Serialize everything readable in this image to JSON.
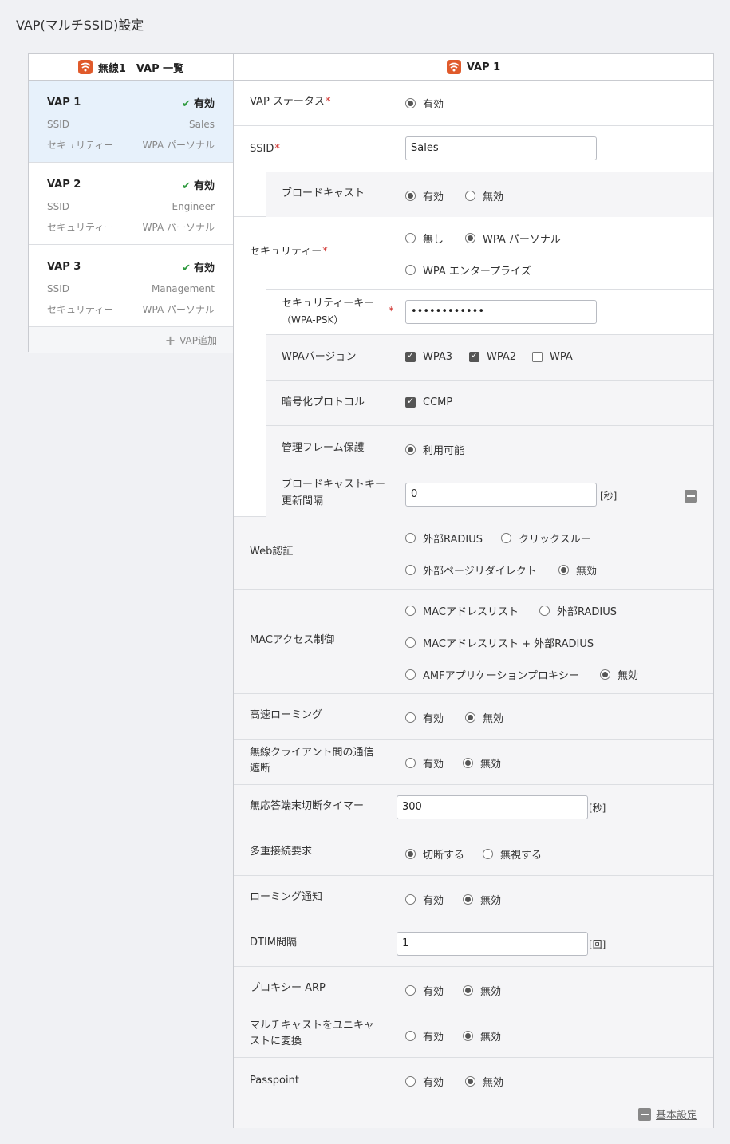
{
  "page_title": "VAP(マルチSSID)設定",
  "vap_list": {
    "header": "無線1　VAP 一覧",
    "items": [
      {
        "name": "VAP 1",
        "status": "有効",
        "ssid_label": "SSID",
        "ssid": "Sales",
        "security_label": "セキュリティー",
        "security": "WPA パーソナル"
      },
      {
        "name": "VAP 2",
        "status": "有効",
        "ssid_label": "SSID",
        "ssid": "Engineer",
        "security_label": "セキュリティー",
        "security": "WPA パーソナル"
      },
      {
        "name": "VAP 3",
        "status": "有効",
        "ssid_label": "SSID",
        "ssid": "Management",
        "security_label": "セキュリティー",
        "security": "WPA パーソナル"
      }
    ],
    "add_label": "VAP追加"
  },
  "detail": {
    "header": "VAP 1",
    "vap_status": {
      "label": "VAP ステータス",
      "required": "*",
      "option": "有効"
    },
    "ssid": {
      "label": "SSID",
      "required": "*",
      "value": "Sales"
    },
    "broadcast": {
      "label": "ブロードキャスト",
      "opt_enable": "有効",
      "opt_disable": "無効"
    },
    "security": {
      "label": "セキュリティー",
      "required": "*",
      "opt_none": "無し",
      "opt_personal": "WPA パーソナル",
      "opt_enterprise": "WPA エンタープライズ"
    },
    "security_key": {
      "label_line1": "セキュリティーキー",
      "label_line2": "（WPA-PSK）",
      "required": "*",
      "value": "••••••••••••"
    },
    "wpa_version": {
      "label": "WPAバージョン",
      "opt1": "WPA3",
      "opt2": "WPA2",
      "opt3": "WPA"
    },
    "encryption": {
      "label": "暗号化プロトコル",
      "opt": "CCMP"
    },
    "mgmt_frame": {
      "label": "管理フレーム保護",
      "opt": "利用可能"
    },
    "broadcast_key": {
      "label_line1": "ブロードキャストキー",
      "label_line2": "更新間隔",
      "value": "0",
      "unit": "[秒]"
    },
    "web_auth": {
      "label": "Web認証",
      "opt1": "外部RADIUS",
      "opt2": "クリックスルー",
      "opt3": "外部ページリダイレクト",
      "opt4": "無効"
    },
    "mac_access": {
      "label": "MACアクセス制御",
      "opt1": "MACアドレスリスト",
      "opt2": "外部RADIUS",
      "opt3": "MACアドレスリスト + 外部RADIUS",
      "opt4": "AMFアプリケーションプロキシー",
      "opt5": "無効"
    },
    "fast_roaming": {
      "label": "高速ローミング",
      "opt_enable": "有効",
      "opt_disable": "無効"
    },
    "client_isolation": {
      "label_line1": "無線クライアント間の通信",
      "label_line2": "遮断",
      "opt_enable": "有効",
      "opt_disable": "無効"
    },
    "inactivity_timer": {
      "label": "無応答端末切断タイマー",
      "value": "300",
      "unit": "[秒]"
    },
    "multi_connect": {
      "label": "多重接続要求",
      "opt1": "切断する",
      "opt2": "無視する"
    },
    "roaming_notify": {
      "label": "ローミング通知",
      "opt_enable": "有効",
      "opt_disable": "無効"
    },
    "dtim": {
      "label": "DTIM間隔",
      "value": "1",
      "unit": "[回]"
    },
    "proxy_arp": {
      "label": "プロキシー ARP",
      "opt_enable": "有効",
      "opt_disable": "無効"
    },
    "mcast_to_ucast": {
      "label_line1": "マルチキャストをユニキャ",
      "label_line2": "ストに変換",
      "opt_enable": "有効",
      "opt_disable": "無効"
    },
    "passpoint": {
      "label": "Passpoint",
      "opt_enable": "有効",
      "opt_disable": "無効"
    },
    "basic_settings_link": "基本設定"
  }
}
